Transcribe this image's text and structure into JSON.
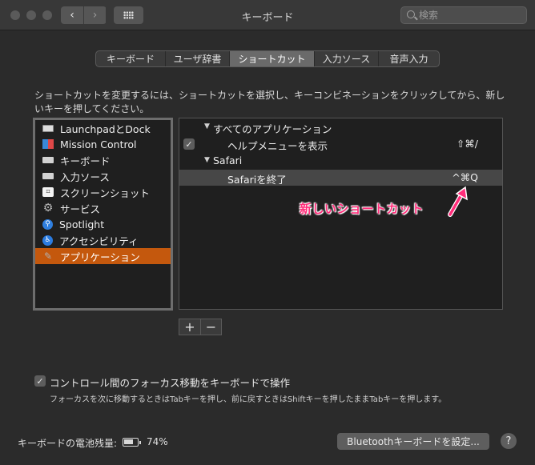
{
  "window": {
    "title": "キーボード",
    "search": {
      "placeholder": "検索"
    },
    "nav_back": "‹",
    "nav_forward": "›"
  },
  "tabs": [
    {
      "label": "キーボード"
    },
    {
      "label": "ユーザ辞書"
    },
    {
      "label": "ショートカット",
      "active": true
    },
    {
      "label": "入力ソース"
    },
    {
      "label": "音声入力"
    }
  ],
  "description": "ショートカットを変更するには、ショートカットを選択し、キーコンビネーションをクリックしてから、新しいキーを押してください。",
  "categories": [
    {
      "label": "LaunchpadとDock",
      "icon": "monitor-icon"
    },
    {
      "label": "Mission Control",
      "icon": "mission-control-icon"
    },
    {
      "label": "キーボード",
      "icon": "keyboard-icon"
    },
    {
      "label": "入力ソース",
      "icon": "keyboard-icon"
    },
    {
      "label": "スクリーンショット",
      "icon": "screenshot-icon"
    },
    {
      "label": "サービス",
      "icon": "gear-icon"
    },
    {
      "label": "Spotlight",
      "icon": "spotlight-icon"
    },
    {
      "label": "アクセシビリティ",
      "icon": "accessibility-icon"
    },
    {
      "label": "アプリケーション",
      "icon": "app-shortcuts-icon",
      "selected": true
    }
  ],
  "shortcuts": {
    "group1": "すべてのアプリケーション",
    "item1": {
      "label": "ヘルプメニューを表示",
      "keys": "⇧⌘/",
      "checked": true
    },
    "group2": "Safari",
    "item2": {
      "label": "Safariを終了",
      "keys": "^⌘Q"
    }
  },
  "annotation": {
    "text": "新しいショートカット",
    "color": "#ff2d7a"
  },
  "buttons": {
    "add": "+",
    "remove": "−"
  },
  "focus_option": {
    "label": "コントロール間のフォーカス移動をキーボードで操作",
    "checked": true,
    "note": "フォーカスを次に移動するときはTabキーを押し、前に戻すときはShiftキーを押したままTabキーを押します。"
  },
  "battery": {
    "label": "キーボードの電池残量:",
    "value": "74%"
  },
  "bluetooth_button": "Bluetoothキーボードを設定...",
  "help_button": "?",
  "colors": {
    "selection": "#c4580d",
    "background": "#2b2b2b",
    "list_bg": "#1f1f1f"
  }
}
